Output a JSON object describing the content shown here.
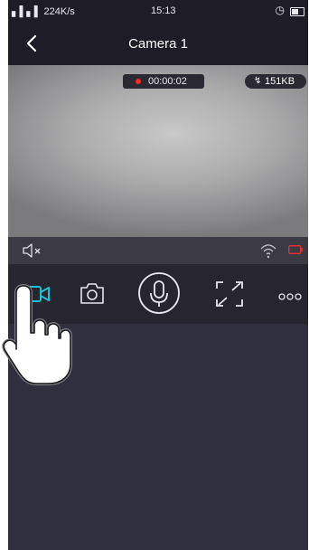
{
  "status_bar": {
    "signal_text": "▖▌▖▌ 224K/s",
    "time": "15:13",
    "alarm_icon": "alarm-icon",
    "battery_icon": "battery-icon"
  },
  "header": {
    "title": "Camera 1",
    "back_icon": "chevron-left-icon"
  },
  "video": {
    "recording_time": "00:00:02",
    "recording_color": "#ff2424",
    "data_size": "151KB",
    "data_size_icon": "lightning-icon"
  },
  "strip": {
    "mute_icon": "speaker-muted-icon",
    "wifi_icon": "wifi-icon",
    "battery_low_icon": "battery-low-icon",
    "battery_low_color": "#e8312b"
  },
  "toolbar": {
    "items": [
      {
        "icon": "video-record-icon",
        "active": true,
        "color": "#18c4d4"
      },
      {
        "icon": "camera-snapshot-icon"
      },
      {
        "icon": "microphone-icon"
      },
      {
        "icon": "fullscreen-icon"
      },
      {
        "icon": "more-icon"
      }
    ]
  },
  "overlay": {
    "hand_pointer_icon": "hand-pointer-icon"
  }
}
